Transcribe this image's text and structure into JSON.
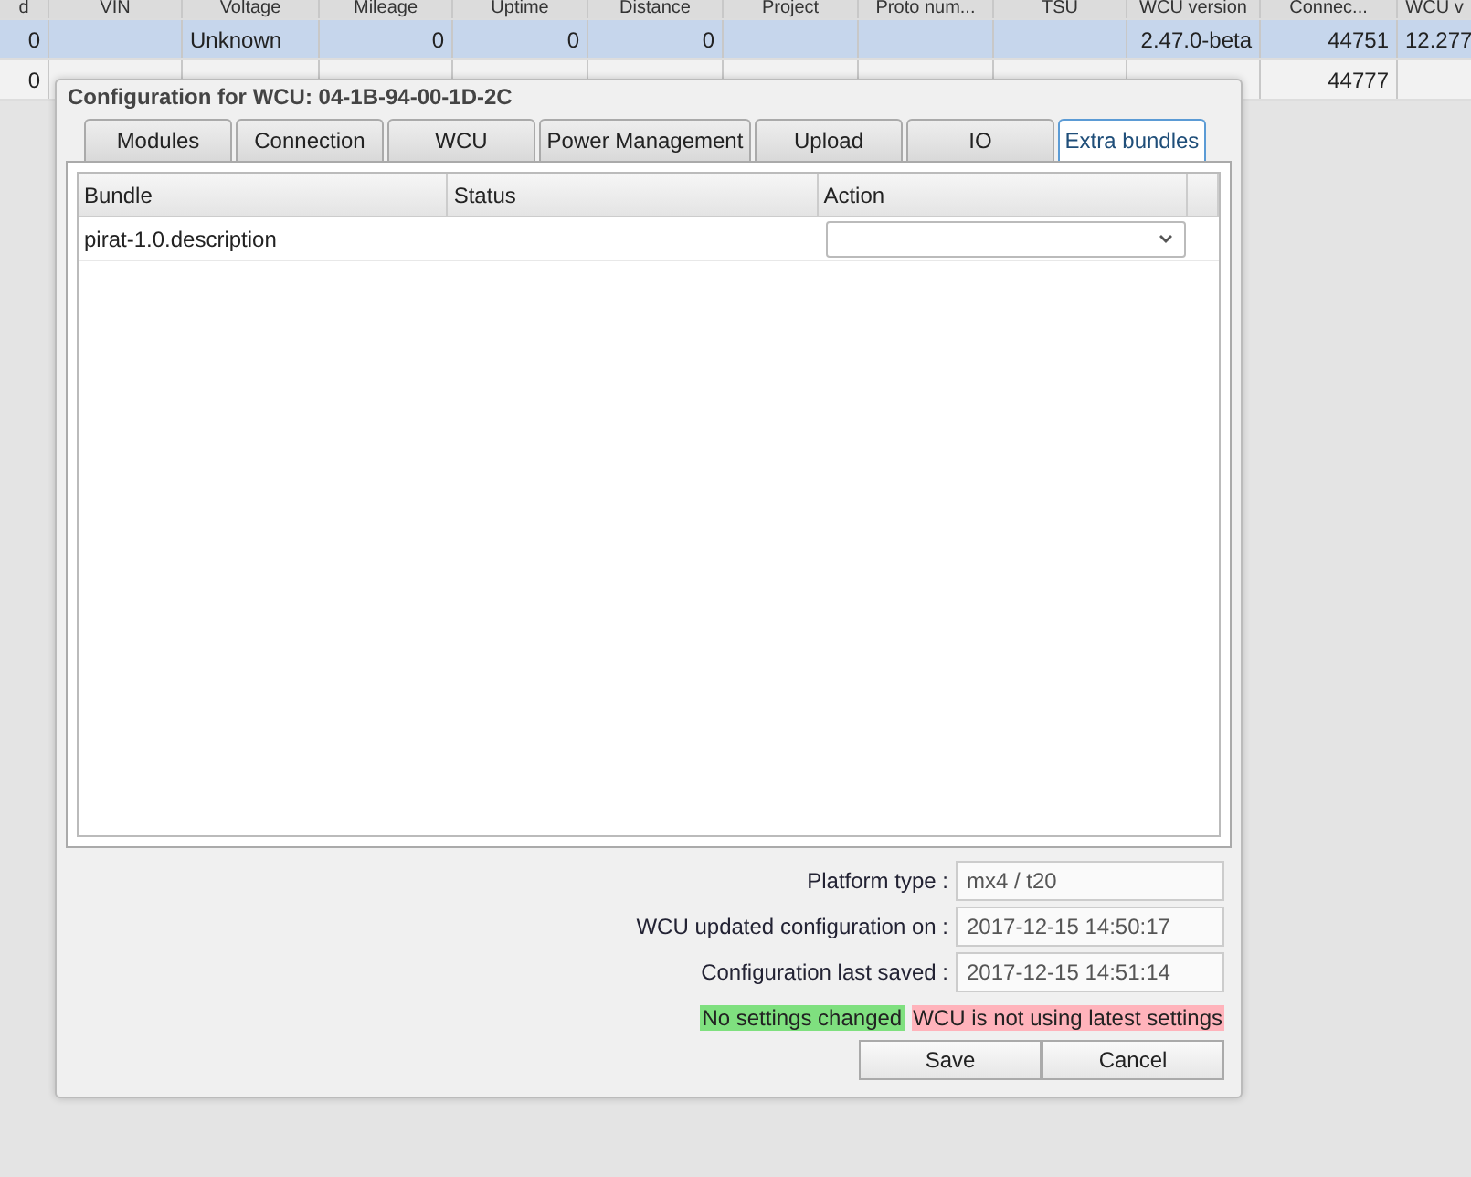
{
  "background_table": {
    "columns": [
      "d",
      "VIN",
      "Voltage",
      "Mileage",
      "Uptime",
      "Distance",
      "Project",
      "Proto num...",
      "TSU",
      "WCU version",
      "Connec...",
      "WCU v"
    ],
    "rows": [
      {
        "selected": true,
        "cells": [
          "0",
          null,
          "Unknown",
          "0",
          "0",
          "0",
          null,
          null,
          null,
          "2.47.0-beta",
          "44751",
          "12.277"
        ]
      },
      {
        "selected": false,
        "cells": [
          "0",
          null,
          null,
          null,
          null,
          null,
          null,
          null,
          null,
          null,
          "44777",
          null
        ]
      }
    ]
  },
  "dialog": {
    "title": "Configuration for WCU: 04-1B-94-00-1D-2C",
    "tabs": [
      {
        "label": "Modules",
        "selected": false
      },
      {
        "label": "Connection",
        "selected": false
      },
      {
        "label": "WCU",
        "selected": false
      },
      {
        "label": "Power Management",
        "selected": false
      },
      {
        "label": "Upload",
        "selected": false
      },
      {
        "label": "IO",
        "selected": false
      },
      {
        "label": "Extra bundles",
        "selected": true
      }
    ],
    "bundles_table": {
      "columns": [
        "Bundle",
        "Status",
        "Action"
      ],
      "rows": [
        {
          "bundle": "pirat-1.0.description",
          "action": {
            "kind": "dropdown"
          }
        }
      ]
    },
    "info_fields": [
      {
        "label": "Platform type :",
        "value": "mx4 / t20"
      },
      {
        "label": "WCU updated configuration on :",
        "value": "2017-12-15 14:50:17"
      },
      {
        "label": "Configuration last saved :",
        "value": "2017-12-15 14:51:14"
      }
    ],
    "statuses": [
      {
        "text": "No settings changed",
        "color": "#7fe07f"
      },
      {
        "text": "WCU is not using latest settings",
        "color": "#ffb3bb"
      }
    ],
    "buttons": [
      "Save",
      "Cancel"
    ]
  }
}
